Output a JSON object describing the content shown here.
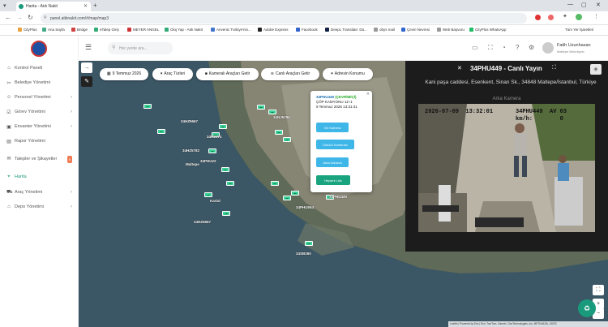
{
  "browser": {
    "tab_title": "Harita - Atık Nakit",
    "url": "panel.atiknakit.com/#/map/map3",
    "bookmarks": [
      "CityPlus",
      "Ana Sayfa",
      "Bridge",
      "eTalep Giriş",
      "MEYER ANGEL",
      "Oloj Yap - Atık Nakit",
      "Anventc Türkiye'nin...",
      "Adobe Express",
      "Facebook",
      "DeepL Translate: Dü...",
      "obys mail",
      "Çeviri Nevresi",
      "Web Başvuru",
      "CityPlus WhatsApp"
    ],
    "all_bookmarks": "Tüm Yer İşaretleri"
  },
  "sidebar": {
    "items": [
      {
        "label": "Kontrol Paneli",
        "icon": "home-icon"
      },
      {
        "label": "Belediye Yönetimi",
        "icon": "tools-icon"
      },
      {
        "label": "Personel Yönetimi",
        "icon": "user-icon"
      },
      {
        "label": "Görev Yönetimi",
        "icon": "task-icon"
      },
      {
        "label": "Envanter Yönetimi",
        "icon": "box-icon"
      },
      {
        "label": "Rapor Yönetimi",
        "icon": "report-icon"
      },
      {
        "label": "Talepler ve Şikayetler",
        "icon": "message-icon",
        "badge": "5"
      },
      {
        "label": "Harita",
        "icon": "map-icon"
      },
      {
        "label": "Araç Yönetimi",
        "icon": "truck-icon"
      },
      {
        "label": "Depo Yönetimi",
        "icon": "warehouse-icon"
      }
    ]
  },
  "header": {
    "search_placeholder": "Her yerde ara...",
    "user_name": "Fatih Uzunhasan",
    "user_role": "Maltepe Belediyesi"
  },
  "map": {
    "filters": {
      "date": "9 Temmuz 2026",
      "vehicle_types": "Araç Türleri",
      "camera_vehicles": "Kameralı Araçları Getir",
      "live_vehicles": "Canlı Araçları Getir",
      "address": "Adresin Konumu"
    },
    "popup": {
      "plate": "34PHU449",
      "status": "(ÇEVRİMİÇİ)",
      "type": "ÇÖP KAMYONU 11+1",
      "datetime": "9 Temmuz 2026 13:31:41",
      "buttons": [
        "Ön Kamera",
        "Sürücü Kamerası",
        "Arka Kamera",
        "Hepsini Lidc"
      ]
    },
    "vehicle_labels": [
      "34HZ5667",
      "34HZ674",
      "34HZ5782",
      "34PHU22",
      "34PHU449",
      "34HZ5667",
      "34SB260",
      "34PHU554",
      "34NJ5796"
    ],
    "place_labels": [
      "Maltepe",
      "Kartal"
    ],
    "zoom_in": "+",
    "zoom_out": "−",
    "attribution": "Leaflet | Powered by Esri | Esri, TomTom, Garmin, GeoTechnologies, Inc, METI/NASA, USGS"
  },
  "live": {
    "title": "34PHU449 - Canlı Yayın",
    "address": "Kani paşa caddesi, Esenkent, Sinan Sk., 34848 Maltepe/İstanbul, Türkiye",
    "camera_label": "Arka Kamera",
    "overlay_datetime": "2026-07-09  13:32:01",
    "overlay_plate": "34PHU449  AV 03",
    "overlay_speed": "km/h:        0"
  }
}
